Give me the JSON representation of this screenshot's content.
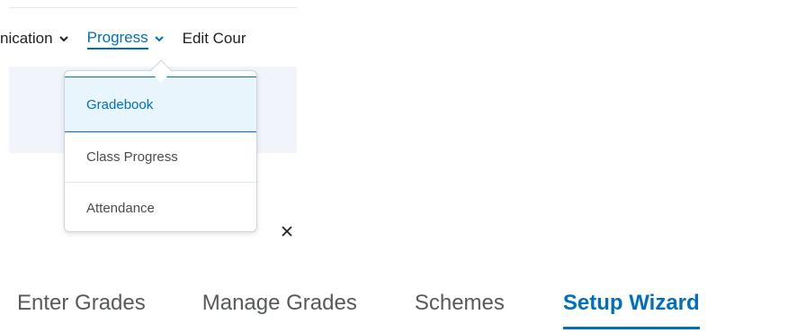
{
  "navbar": {
    "items": [
      {
        "label": "nication"
      },
      {
        "label": "Progress"
      },
      {
        "label": "Edit Cour"
      }
    ]
  },
  "dropdown": {
    "items": [
      {
        "label": "Gradebook"
      },
      {
        "label": "Class Progress"
      },
      {
        "label": "Attendance"
      }
    ]
  },
  "close_symbol": "×",
  "tabs": [
    {
      "label": "Enter Grades"
    },
    {
      "label": "Manage Grades"
    },
    {
      "label": "Schemes"
    },
    {
      "label": "Setup Wizard"
    }
  ],
  "colors": {
    "accent": "#006fbf",
    "selected_bg": "#e8f5fd",
    "panel_bg": "#f1f5fb",
    "text": "#494c4e"
  }
}
